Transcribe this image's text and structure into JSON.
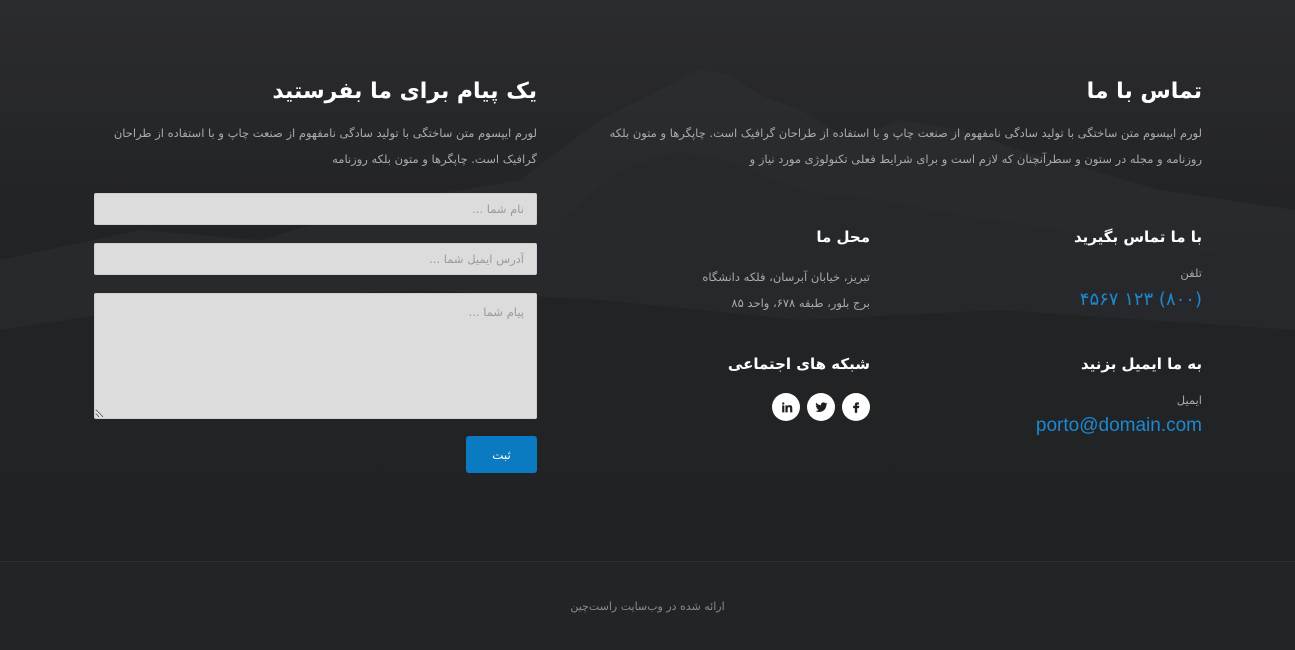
{
  "contact": {
    "title": "تماس با ما",
    "description": "لورم ایپسوم متن ساختگی با تولید سادگی نامفهوم از صنعت چاپ و با استفاده از طراحان گرافیک است. چاپگرها و متون بلکه روزنامه و مجله در ستون و سطرآنچنان که لازم است و برای شرایط فعلی تکنولوژی مورد نیاز و"
  },
  "call": {
    "heading": "با ما تماس بگیرید",
    "phone_label": "تلفن",
    "phone": "(۸۰۰) ۱۲۳ ۴۵۶۷"
  },
  "location": {
    "heading": "محل ما",
    "line1": "تبریز، خیابان آبرسان، فلکه دانشگاه",
    "line2": "برج بلور، طبقه ۶۷۸، واحد ۸۵"
  },
  "email_section": {
    "heading": "به ما ایمیل بزنید",
    "email_label": "ایمیل",
    "email": "porto@domain.com"
  },
  "social": {
    "heading": "شبکه های اجتماعی",
    "icons": [
      "facebook-icon",
      "twitter-icon",
      "linkedin-icon"
    ]
  },
  "form": {
    "title": "یک پیام برای ما بفرستید",
    "description": "لورم ایپسوم متن ساختگی با تولید سادگی نامفهوم از صنعت چاپ و با استفاده از طراحان گرافیک است. چاپگرها و متون بلکه روزنامه",
    "name_placeholder": "نام شما ...",
    "email_placeholder": "آدرس ایمیل شما ...",
    "message_placeholder": "پیام شما ...",
    "submit_label": "ثبت"
  },
  "footer": {
    "text": "ارائه شده در وب‌سایت راست‌چین"
  },
  "colors": {
    "accent": "#1e88d0",
    "button": "#0b7bc1",
    "background": "#1f2023"
  }
}
